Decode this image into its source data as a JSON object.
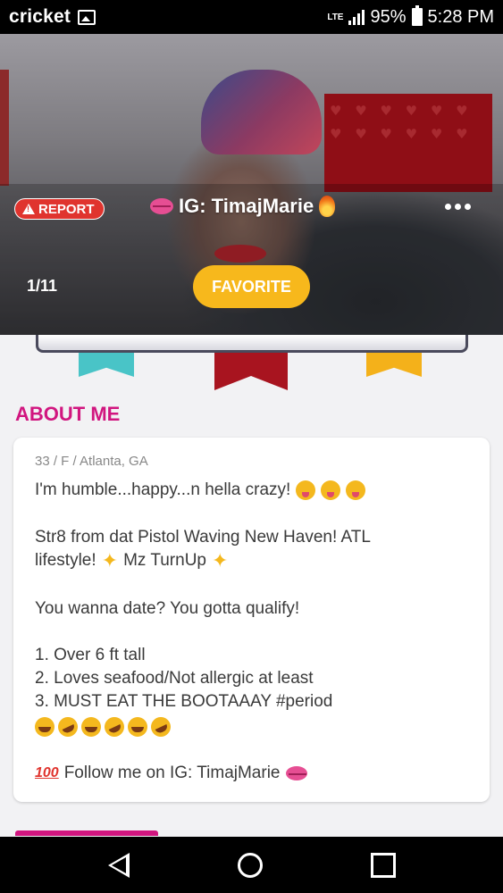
{
  "status_bar": {
    "carrier": "cricket",
    "network": "LTE",
    "battery": "95%",
    "time": "5:28 PM",
    "icons": [
      "image-icon",
      "signal-icon",
      "battery-icon"
    ]
  },
  "profile": {
    "report_label": "REPORT",
    "ig_name": "IG: TimajMarie",
    "photo_counter": "1/11",
    "favorite_label": "FAVORITE",
    "more_icon": "more-dots-icon"
  },
  "about": {
    "heading": "ABOUT ME",
    "demographics": "33 / F / Atlanta, GA",
    "lines": [
      "I'm humble...happy...n hella crazy!",
      "Str8 from dat Pistol Waving New Haven! ATL",
      "lifestyle!",
      "Mz TurnUp",
      "You wanna date? You gotta qualify!",
      "1. Over 6 ft tall",
      "2. Loves seafood/Not allergic at least",
      "3. MUST EAT THE BOOTAAAY #period",
      "Follow me on IG: TimajMarie"
    ]
  },
  "colors": {
    "accent": "#d1167f",
    "report": "#e0342e",
    "favorite": "#f7b81c",
    "ribbon_teal": "#49c4c7",
    "ribbon_red": "#a8141f",
    "ribbon_yellow": "#f4b11a"
  },
  "nav": {
    "icons": [
      "back-icon",
      "home-icon",
      "recent-apps-icon"
    ]
  }
}
